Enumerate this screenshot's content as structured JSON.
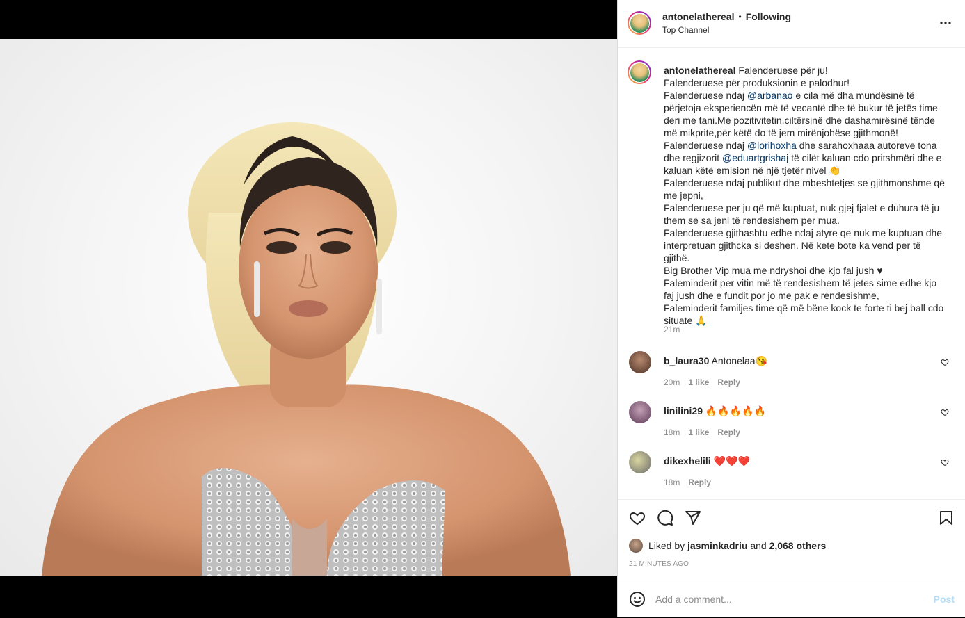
{
  "post": {
    "username": "antonelathereal",
    "separator": "•",
    "follow_state": "Following",
    "subtitle": "Top Channel",
    "caption_lines": [
      "Falenderuese për ju!",
      "Falenderuese për produksionin e palodhur!",
      "Falenderuese ndaj ",
      "e cila më dha mundësinë të përjetoja eksperiencën më të vecantë dhe të bukur të jetës time deri me tani.Me pozitivitetin,ciltërsinë dhe dashamirësinë tënde më mikprite,për këtë do të jem mirënjohëse gjithmonë!",
      "Falenderuese ndaj ",
      "dhe sarahoxhaaa autoreve tona dhe regjizorit ",
      "të cilët kaluan cdo pritshmëri dhe e kaluan këtë emision në një tjetër nivel 👏",
      "Falenderuese ndaj publikut dhe mbeshtetjes se gjithmonshme që me jepni,",
      "Falenderuese per ju që më kuptuat, nuk gjej fjalet e duhura të ju them se sa jeni të rendesishem per mua.",
      "Falenderuese gjithashtu edhe ndaj atyre qe nuk me kuptuan dhe interpretuan gjithcka si deshen. Në kete bote ka vend per të gjithë.",
      "Big Brother Vip mua me ndryshoi dhe kjo fal jush ♥",
      "Faleminderit per vitin më të rendesishem të jetes sime edhe kjo faj jush dhe e fundit por jo me pak e rendesishme,",
      "Faleminderit familjes time që më bëne kock te forte ti bej ball cdo situate 🙏"
    ],
    "mentions": [
      "@arbanao",
      "@lorihoxha",
      "@eduartgrishaj"
    ],
    "caption_time": "21m",
    "more_icon": "more-horizontal-icon"
  },
  "comments": [
    {
      "username": "b_laura30",
      "text": "Antonelaa😘",
      "time": "20m",
      "likes": "1 like",
      "reply": "Reply",
      "avatar_color": "#6b4a3a"
    },
    {
      "username": "linilini29",
      "text": "🔥🔥🔥🔥🔥",
      "time": "18m",
      "likes": "1 like",
      "reply": "Reply",
      "avatar_color": "#7a5a7a"
    },
    {
      "username": "dikexhelili",
      "text": "❤️❤️❤️",
      "time": "18m",
      "likes": "",
      "reply": "Reply",
      "avatar_color": "#8a8a8a"
    }
  ],
  "actions": {
    "like_icon": "heart-icon",
    "comment_icon": "comment-icon",
    "share_icon": "share-icon",
    "save_icon": "bookmark-icon"
  },
  "likes": {
    "prefix": "Liked by",
    "user": "jasminkadriu",
    "and": "and",
    "others": "2,068 others"
  },
  "timestamp": "21 MINUTES AGO",
  "add_comment": {
    "emoji_icon": "emoji-icon",
    "placeholder": "Add a comment...",
    "post_label": "Post"
  },
  "colors": {
    "accent": "#0095f6",
    "post_disabled": "#b2dffc",
    "link": "#00376b",
    "like_red": "#ed4956"
  }
}
